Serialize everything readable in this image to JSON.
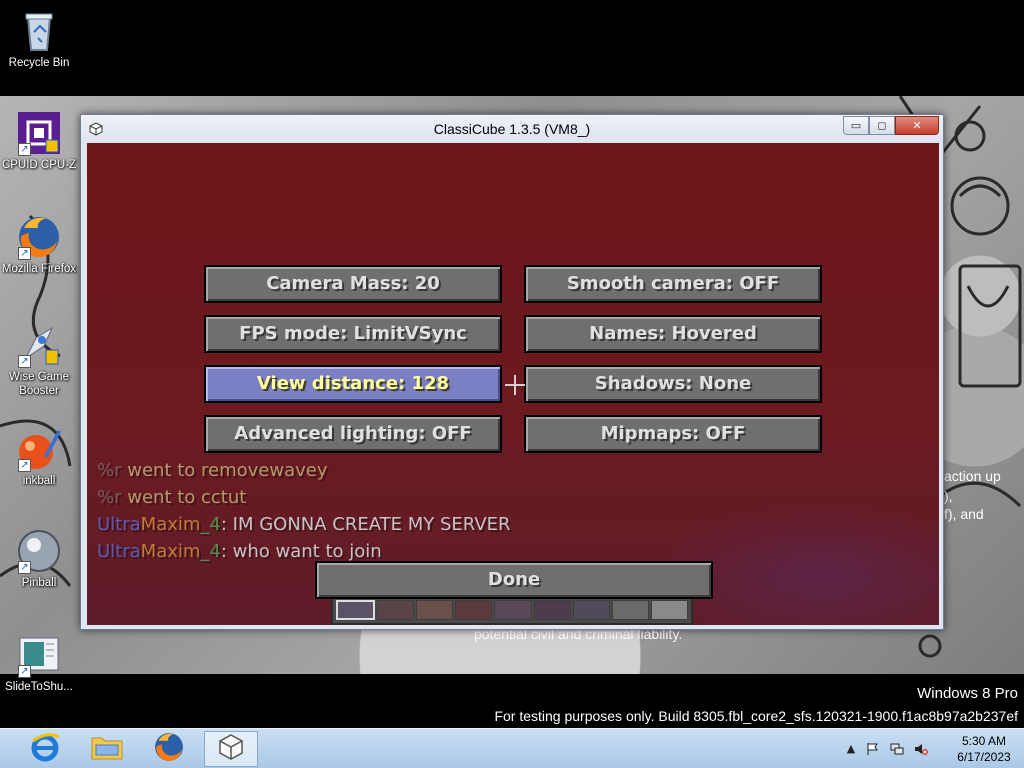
{
  "desktop": {
    "icons": [
      {
        "label": "Recycle Bin",
        "icon": "recycle-bin-icon"
      },
      {
        "label": "CPUID CPU-Z",
        "icon": "cpu-z-icon"
      },
      {
        "label": "Mozilla Firefox",
        "icon": "firefox-icon"
      },
      {
        "label": "Wise Game Booster",
        "icon": "wise-game-booster-icon"
      },
      {
        "label": "inkball",
        "icon": "inkball-icon"
      },
      {
        "label": "Pinball",
        "icon": "pinball-icon"
      },
      {
        "label": "SlideToShu...",
        "icon": "slide-to-shutdown-icon"
      }
    ],
    "background_text": {
      "line1": "action up",
      "line2": "),",
      "line3": "f), and",
      "line4": "potential civil and criminal liability."
    }
  },
  "window": {
    "title": "ClassiCube 1.3.5 (VM8_)",
    "controls": {
      "minimize": "▭",
      "maximize": "◻",
      "close": "✕"
    }
  },
  "options_menu": {
    "buttons": [
      {
        "label": "Camera Mass: 20"
      },
      {
        "label": "Smooth camera: OFF"
      },
      {
        "label": "FPS mode: LimitVSync"
      },
      {
        "label": "Names: Hovered"
      },
      {
        "label": "View distance: 128",
        "hovered": true
      },
      {
        "label": "Shadows: None"
      },
      {
        "label": "Advanced lighting: OFF"
      },
      {
        "label": "Mipmaps: OFF"
      }
    ],
    "done": "Done"
  },
  "chat": [
    {
      "prefix": "%r",
      "text": " went to removewavey"
    },
    {
      "prefix": "%r",
      "text": " went to cctut"
    },
    {
      "name1": "Ultra",
      "name2": "Maxim",
      "suffix": "_4",
      "text": ": IM GONNA CREATE MY SERVER"
    },
    {
      "name1": "Ultra",
      "name2": "Maxim",
      "suffix": "_4",
      "text": ": who want to join"
    }
  ],
  "hotbar": {
    "slots": 9,
    "selected": 1
  },
  "watermark": {
    "edition": "Windows 8 Pro",
    "build": "For testing purposes only. Build 8305.fbl_core2_sfs.120321-1900.f1ac8b97a2b237ef"
  },
  "taskbar": {
    "apps": [
      {
        "icon": "internet-explorer-icon"
      },
      {
        "icon": "file-explorer-icon"
      },
      {
        "icon": "firefox-icon"
      },
      {
        "icon": "classicube-icon",
        "active": true
      }
    ],
    "tray": {
      "show_hidden": "▲",
      "time": "5:30 AM",
      "date": "6/17/2023"
    }
  }
}
